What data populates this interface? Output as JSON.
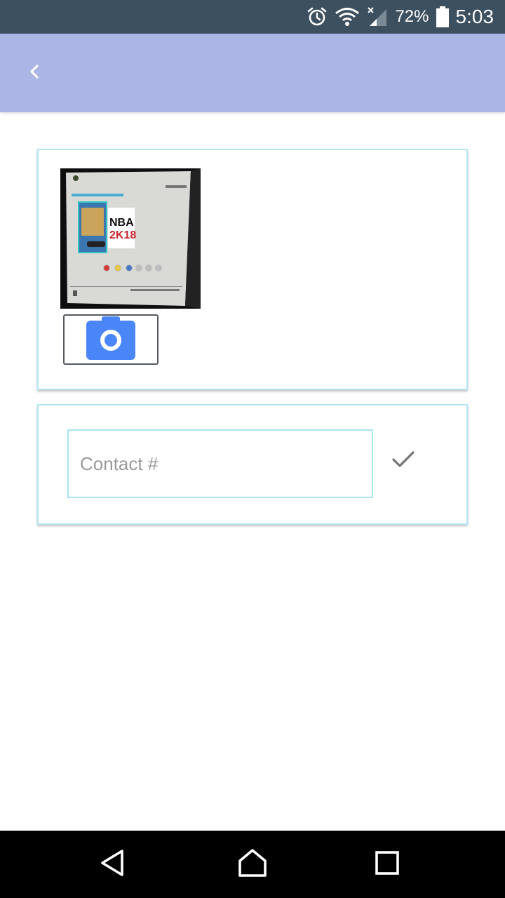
{
  "status_bar": {
    "battery_percent": "72%",
    "time": "5:03",
    "icons": [
      "alarm-icon",
      "wifi-icon",
      "signal-icon",
      "battery-icon"
    ]
  },
  "app_bar": {
    "back_icon": "chevron-left-icon",
    "background_color": "#abb6e6"
  },
  "photo_card": {
    "thumbnail": {
      "label": "NBA",
      "sublabel": "2K18"
    },
    "camera_icon": "camera-icon",
    "accent_color": "#4a86f7"
  },
  "contact_card": {
    "input_placeholder": "Contact #",
    "input_value": "",
    "confirm_icon": "check-icon"
  },
  "nav_bar": {
    "icons": [
      "back-triangle-icon",
      "home-icon",
      "recents-icon"
    ]
  }
}
